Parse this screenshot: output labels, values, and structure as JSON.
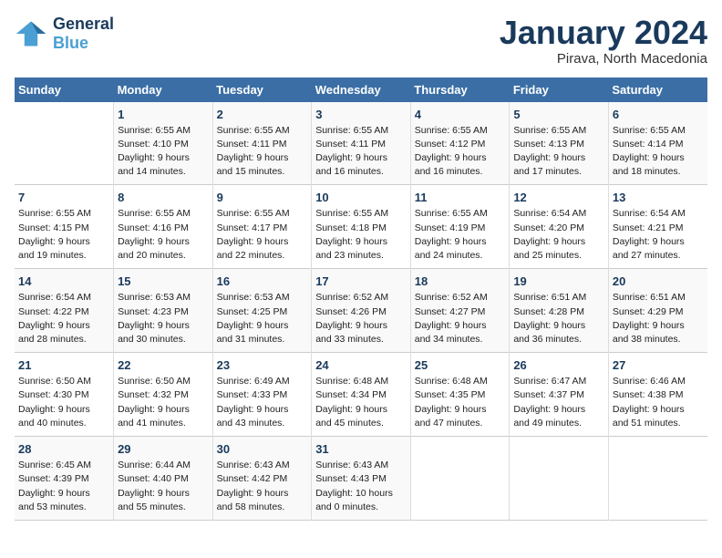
{
  "header": {
    "logo_line1": "General",
    "logo_line2": "Blue",
    "month": "January 2024",
    "location": "Pirava, North Macedonia"
  },
  "weekdays": [
    "Sunday",
    "Monday",
    "Tuesday",
    "Wednesday",
    "Thursday",
    "Friday",
    "Saturday"
  ],
  "weeks": [
    [
      {
        "day": "",
        "text": ""
      },
      {
        "day": "1",
        "text": "Sunrise: 6:55 AM\nSunset: 4:10 PM\nDaylight: 9 hours\nand 14 minutes."
      },
      {
        "day": "2",
        "text": "Sunrise: 6:55 AM\nSunset: 4:11 PM\nDaylight: 9 hours\nand 15 minutes."
      },
      {
        "day": "3",
        "text": "Sunrise: 6:55 AM\nSunset: 4:11 PM\nDaylight: 9 hours\nand 16 minutes."
      },
      {
        "day": "4",
        "text": "Sunrise: 6:55 AM\nSunset: 4:12 PM\nDaylight: 9 hours\nand 16 minutes."
      },
      {
        "day": "5",
        "text": "Sunrise: 6:55 AM\nSunset: 4:13 PM\nDaylight: 9 hours\nand 17 minutes."
      },
      {
        "day": "6",
        "text": "Sunrise: 6:55 AM\nSunset: 4:14 PM\nDaylight: 9 hours\nand 18 minutes."
      }
    ],
    [
      {
        "day": "7",
        "text": "Sunrise: 6:55 AM\nSunset: 4:15 PM\nDaylight: 9 hours\nand 19 minutes."
      },
      {
        "day": "8",
        "text": "Sunrise: 6:55 AM\nSunset: 4:16 PM\nDaylight: 9 hours\nand 20 minutes."
      },
      {
        "day": "9",
        "text": "Sunrise: 6:55 AM\nSunset: 4:17 PM\nDaylight: 9 hours\nand 22 minutes."
      },
      {
        "day": "10",
        "text": "Sunrise: 6:55 AM\nSunset: 4:18 PM\nDaylight: 9 hours\nand 23 minutes."
      },
      {
        "day": "11",
        "text": "Sunrise: 6:55 AM\nSunset: 4:19 PM\nDaylight: 9 hours\nand 24 minutes."
      },
      {
        "day": "12",
        "text": "Sunrise: 6:54 AM\nSunset: 4:20 PM\nDaylight: 9 hours\nand 25 minutes."
      },
      {
        "day": "13",
        "text": "Sunrise: 6:54 AM\nSunset: 4:21 PM\nDaylight: 9 hours\nand 27 minutes."
      }
    ],
    [
      {
        "day": "14",
        "text": "Sunrise: 6:54 AM\nSunset: 4:22 PM\nDaylight: 9 hours\nand 28 minutes."
      },
      {
        "day": "15",
        "text": "Sunrise: 6:53 AM\nSunset: 4:23 PM\nDaylight: 9 hours\nand 30 minutes."
      },
      {
        "day": "16",
        "text": "Sunrise: 6:53 AM\nSunset: 4:25 PM\nDaylight: 9 hours\nand 31 minutes."
      },
      {
        "day": "17",
        "text": "Sunrise: 6:52 AM\nSunset: 4:26 PM\nDaylight: 9 hours\nand 33 minutes."
      },
      {
        "day": "18",
        "text": "Sunrise: 6:52 AM\nSunset: 4:27 PM\nDaylight: 9 hours\nand 34 minutes."
      },
      {
        "day": "19",
        "text": "Sunrise: 6:51 AM\nSunset: 4:28 PM\nDaylight: 9 hours\nand 36 minutes."
      },
      {
        "day": "20",
        "text": "Sunrise: 6:51 AM\nSunset: 4:29 PM\nDaylight: 9 hours\nand 38 minutes."
      }
    ],
    [
      {
        "day": "21",
        "text": "Sunrise: 6:50 AM\nSunset: 4:30 PM\nDaylight: 9 hours\nand 40 minutes."
      },
      {
        "day": "22",
        "text": "Sunrise: 6:50 AM\nSunset: 4:32 PM\nDaylight: 9 hours\nand 41 minutes."
      },
      {
        "day": "23",
        "text": "Sunrise: 6:49 AM\nSunset: 4:33 PM\nDaylight: 9 hours\nand 43 minutes."
      },
      {
        "day": "24",
        "text": "Sunrise: 6:48 AM\nSunset: 4:34 PM\nDaylight: 9 hours\nand 45 minutes."
      },
      {
        "day": "25",
        "text": "Sunrise: 6:48 AM\nSunset: 4:35 PM\nDaylight: 9 hours\nand 47 minutes."
      },
      {
        "day": "26",
        "text": "Sunrise: 6:47 AM\nSunset: 4:37 PM\nDaylight: 9 hours\nand 49 minutes."
      },
      {
        "day": "27",
        "text": "Sunrise: 6:46 AM\nSunset: 4:38 PM\nDaylight: 9 hours\nand 51 minutes."
      }
    ],
    [
      {
        "day": "28",
        "text": "Sunrise: 6:45 AM\nSunset: 4:39 PM\nDaylight: 9 hours\nand 53 minutes."
      },
      {
        "day": "29",
        "text": "Sunrise: 6:44 AM\nSunset: 4:40 PM\nDaylight: 9 hours\nand 55 minutes."
      },
      {
        "day": "30",
        "text": "Sunrise: 6:43 AM\nSunset: 4:42 PM\nDaylight: 9 hours\nand 58 minutes."
      },
      {
        "day": "31",
        "text": "Sunrise: 6:43 AM\nSunset: 4:43 PM\nDaylight: 10 hours\nand 0 minutes."
      },
      {
        "day": "",
        "text": ""
      },
      {
        "day": "",
        "text": ""
      },
      {
        "day": "",
        "text": ""
      }
    ]
  ]
}
